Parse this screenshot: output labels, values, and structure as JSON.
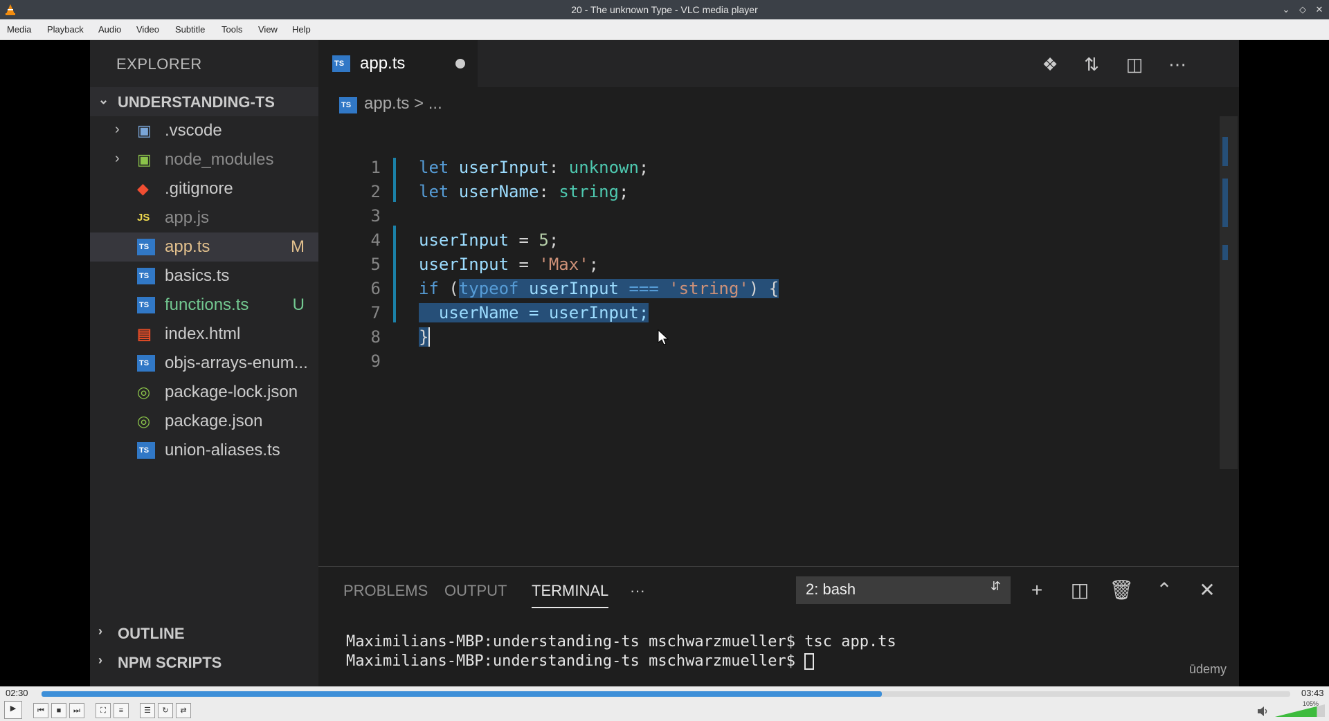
{
  "window": {
    "title": "20 - The unknown Type - VLC media player"
  },
  "menu": [
    "Media",
    "Playback",
    "Audio",
    "Video",
    "Subtitle",
    "Tools",
    "View",
    "Help"
  ],
  "explorer": {
    "header": "EXPLORER",
    "project": "UNDERSTANDING-TS",
    "files": [
      {
        "name": ".vscode",
        "icon": "folder-icon",
        "folder": true,
        "badge": ""
      },
      {
        "name": "node_modules",
        "icon": "folder-icon",
        "folder": true,
        "badge": ""
      },
      {
        "name": ".gitignore",
        "icon": "git-icon",
        "folder": false,
        "badge": ""
      },
      {
        "name": "app.js",
        "icon": "js-icon",
        "folder": false,
        "badge": ""
      },
      {
        "name": "app.ts",
        "icon": "ts-icon",
        "folder": false,
        "badge": "M"
      },
      {
        "name": "basics.ts",
        "icon": "ts-icon",
        "folder": false,
        "badge": ""
      },
      {
        "name": "functions.ts",
        "icon": "ts-icon",
        "folder": false,
        "badge": "U"
      },
      {
        "name": "index.html",
        "icon": "html-icon",
        "folder": false,
        "badge": ""
      },
      {
        "name": "objs-arrays-enum...",
        "icon": "ts-icon",
        "folder": false,
        "badge": ""
      },
      {
        "name": "package-lock.json",
        "icon": "json-icon",
        "folder": false,
        "badge": ""
      },
      {
        "name": "package.json",
        "icon": "json-icon",
        "folder": false,
        "badge": ""
      },
      {
        "name": "union-aliases.ts",
        "icon": "ts-icon",
        "folder": false,
        "badge": ""
      }
    ],
    "outline": "OUTLINE",
    "npm_scripts": "NPM SCRIPTS"
  },
  "editor": {
    "tab": "app.ts",
    "ts_icon_label": "TS",
    "js_icon_label": "JS",
    "breadcrumb": "app.ts > ...",
    "line_numbers": [
      "1",
      "2",
      "3",
      "4",
      "5",
      "6",
      "7",
      "8",
      "9"
    ],
    "code": {
      "l1": [
        "let",
        " userInput",
        ": ",
        "unknown",
        ";"
      ],
      "l2": [
        "let",
        " userName",
        ": ",
        "string",
        ";"
      ],
      "l4": [
        "userInput",
        " = ",
        "5",
        ";"
      ],
      "l5": [
        "userInput",
        " = ",
        "'Max'",
        ";"
      ],
      "l6": [
        "if",
        " (",
        "typeof",
        " userInput ",
        "===",
        " ",
        "'string'",
        ") {"
      ],
      "l7": [
        "  userName = userInput;"
      ],
      "l8": [
        "}"
      ]
    }
  },
  "panel": {
    "tabs": [
      "PROBLEMS",
      "OUTPUT",
      "TERMINAL"
    ],
    "more": "···",
    "terminal_select": "2: bash",
    "terminal_lines": [
      "Maximilians-MBP:understanding-ts mschwarzmueller$ tsc app.ts",
      "Maximilians-MBP:understanding-ts mschwarzmueller$ "
    ],
    "watermark": "ūdemy"
  },
  "player": {
    "elapsed": "02:30",
    "total": "03:43",
    "progress": 0.673,
    "volume_label": "105%",
    "volume": 1.05
  }
}
